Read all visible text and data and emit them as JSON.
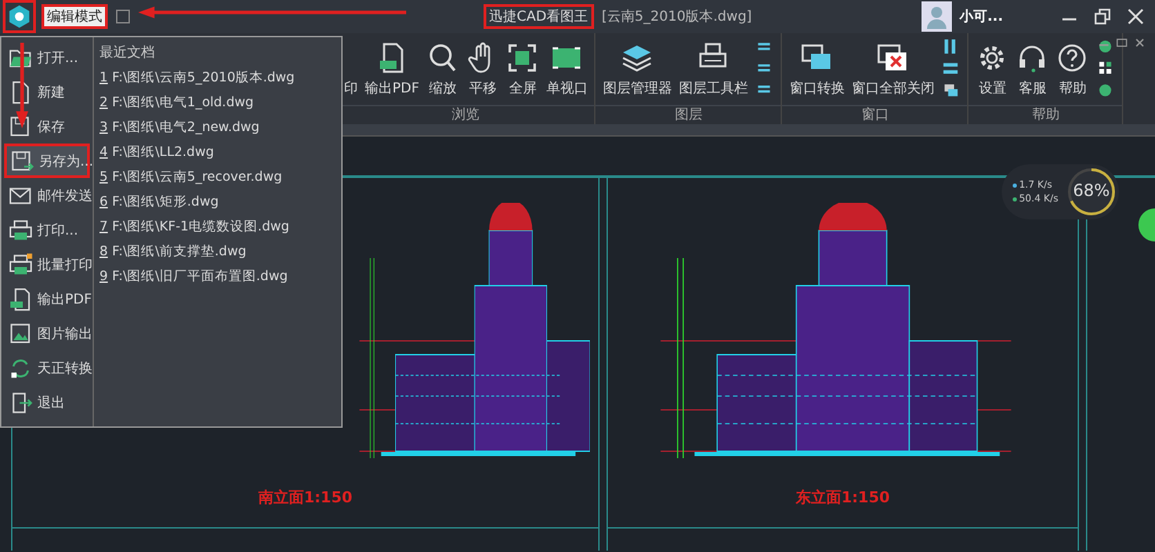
{
  "titlebar": {
    "mode_label": "编辑模式",
    "app_name": "迅捷CAD看图王",
    "file_name": "[云南5_2010版本.dwg]",
    "user_name": "小可..."
  },
  "ribbon": {
    "groups": [
      {
        "label": "浏览",
        "buttons": [
          {
            "label": "印",
            "kind": "hidden"
          },
          {
            "label": "输出PDF",
            "kind": "pdf"
          },
          {
            "label": "缩放",
            "kind": "zoom"
          },
          {
            "label": "平移",
            "kind": "pan"
          },
          {
            "label": "全屏",
            "kind": "fullscreen"
          },
          {
            "label": "单视口",
            "kind": "viewport"
          }
        ]
      },
      {
        "label": "图层",
        "buttons": [
          {
            "label": "图层管理器",
            "kind": "layers"
          },
          {
            "label": "图层工具栏",
            "kind": "toolbar"
          },
          {
            "kind": "mini-layers"
          }
        ]
      },
      {
        "label": "窗口",
        "buttons": [
          {
            "label": "窗口转换",
            "kind": "switch"
          },
          {
            "label": "窗口全部关闭",
            "kind": "closeall"
          },
          {
            "kind": "mini-window"
          }
        ]
      },
      {
        "label": "帮助",
        "buttons": [
          {
            "label": "设置",
            "kind": "settings"
          },
          {
            "label": "客服",
            "kind": "support"
          },
          {
            "label": "帮助",
            "kind": "help"
          },
          {
            "kind": "mini-help"
          }
        ]
      }
    ]
  },
  "file_menu": {
    "items": [
      {
        "label": "打开...",
        "kind": "open",
        "selected": false
      },
      {
        "label": "新建",
        "kind": "new",
        "selected": false
      },
      {
        "label": "保存",
        "kind": "save",
        "selected": false
      },
      {
        "label": "另存为...",
        "kind": "saveas",
        "selected": true
      },
      {
        "label": "邮件发送",
        "kind": "mail",
        "selected": false
      },
      {
        "label": "打印...",
        "kind": "print",
        "selected": false
      },
      {
        "label": "批量打印",
        "kind": "batch",
        "selected": false
      },
      {
        "label": "输出PDF",
        "kind": "pdf",
        "selected": false
      },
      {
        "label": "图片输出",
        "kind": "image",
        "selected": false
      },
      {
        "label": "天正转换",
        "kind": "convert",
        "selected": false
      },
      {
        "label": "退出",
        "kind": "exit",
        "selected": false
      }
    ],
    "recent_title": "最近文档",
    "recent": [
      {
        "index": "1",
        "path": "F:\\图纸\\云南5_2010版本.dwg"
      },
      {
        "index": "2",
        "path": "F:\\图纸\\电气1_old.dwg"
      },
      {
        "index": "3",
        "path": "F:\\图纸\\电气2_new.dwg"
      },
      {
        "index": "4",
        "path": "F:\\图纸\\LL2.dwg"
      },
      {
        "index": "5",
        "path": "F:\\图纸\\云南5_recover.dwg"
      },
      {
        "index": "6",
        "path": "F:\\图纸\\矩形.dwg"
      },
      {
        "index": "7",
        "path": "F:\\图纸\\KF-1电缆数设图.dwg"
      },
      {
        "index": "8",
        "path": "F:\\图纸\\前支撑垫.dwg"
      },
      {
        "index": "9",
        "path": "F:\\图纸\\旧厂平面布置图.dwg"
      }
    ]
  },
  "network_widget": {
    "upload": "1.7 K/s",
    "download": "50.4 K/s",
    "percent": "68%",
    "level": 0.68
  },
  "drawings": [
    {
      "caption": "南立面1:150"
    },
    {
      "caption": "东立面1:150"
    }
  ]
}
